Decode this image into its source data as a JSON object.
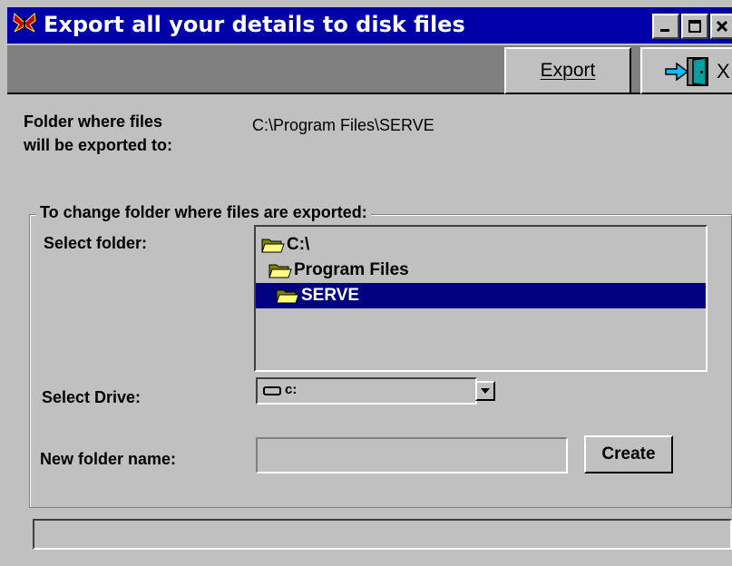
{
  "window": {
    "title": "Export all your details to disk files",
    "app_icon": "butterfly-icon"
  },
  "titlebar_buttons": {
    "minimize_icon": "minimize-icon",
    "maximize_icon": "maximize-icon",
    "close_icon": "close-icon"
  },
  "toolbar": {
    "export_label": "Export",
    "exit_icon": "exit-door-icon",
    "exit_label": "X"
  },
  "destination": {
    "label_line1": "Folder where files",
    "label_line2": "will be exported to:",
    "path": "C:\\Program Files\\SERVE"
  },
  "change_group": {
    "title": "To change folder where files are exported:",
    "select_folder_label": "Select folder:",
    "folder_tree": [
      {
        "name": "C:\\",
        "selected": false,
        "icon": "open-folder-icon"
      },
      {
        "name": "Program Files",
        "selected": false,
        "icon": "open-folder-icon"
      },
      {
        "name": "SERVE",
        "selected": true,
        "icon": "open-folder-icon"
      }
    ],
    "select_drive_label": "Select Drive:",
    "drive_value": "c:",
    "drive_icon": "drive-icon",
    "new_folder_label": "New folder name:",
    "new_folder_value": "",
    "create_label": "Create"
  },
  "colors": {
    "title_bg": "#0000a8",
    "selection_bg": "#000080",
    "window_bg": "#c0c0c0",
    "toolbar_bg": "#808080"
  },
  "status": {
    "text": ""
  }
}
